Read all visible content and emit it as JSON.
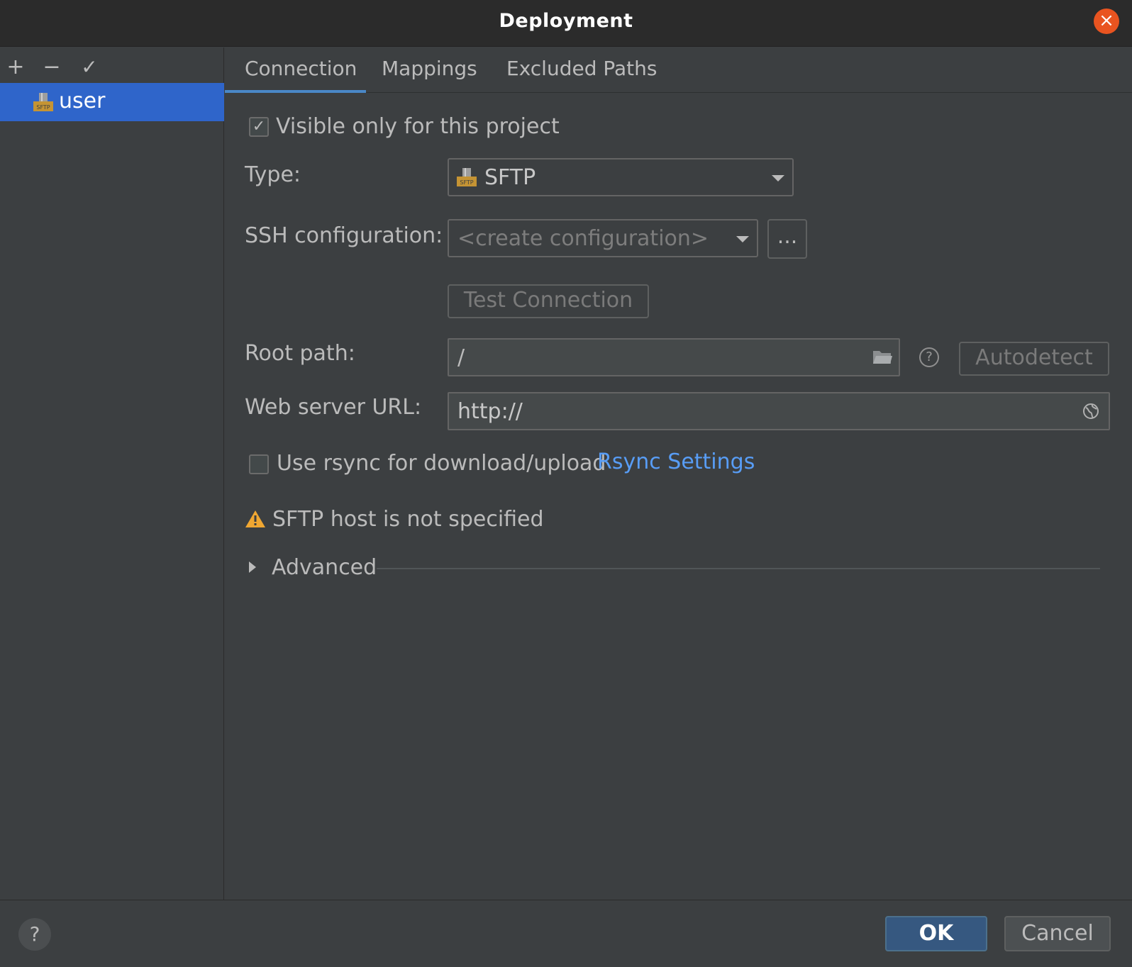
{
  "window": {
    "title": "Deployment"
  },
  "sidebar": {
    "toolbar": {
      "add": "+",
      "remove": "−",
      "apply": "✓"
    },
    "items": [
      {
        "label": "user",
        "icon": "sftp-server-icon"
      }
    ]
  },
  "tabs": [
    {
      "label": "Connection",
      "active": true
    },
    {
      "label": "Mappings",
      "active": false
    },
    {
      "label": "Excluded Paths",
      "active": false
    }
  ],
  "form": {
    "visible_only": {
      "label": "Visible only for this project",
      "checked": true
    },
    "type": {
      "label": "Type:",
      "value": "SFTP",
      "icon": "sftp-icon"
    },
    "ssh": {
      "label": "SSH configuration:",
      "value": "<create configuration>",
      "browse_label": "..."
    },
    "test_connection_label": "Test Connection",
    "root_path": {
      "label": "Root path:",
      "value": "/",
      "autodetect_label": "Autodetect"
    },
    "web_url": {
      "label": "Web server URL:",
      "value": "http://"
    },
    "rsync": {
      "label": "Use rsync for download/upload",
      "checked": false,
      "link": "Rsync Settings"
    },
    "warning": "SFTP host is not specified",
    "advanced_label": "Advanced"
  },
  "footer": {
    "help": "?",
    "ok": "OK",
    "cancel": "Cancel"
  },
  "colors": {
    "accent": "#2f65ca",
    "link": "#589df6",
    "warning": "#f0a732",
    "ok_button": "#365880"
  }
}
